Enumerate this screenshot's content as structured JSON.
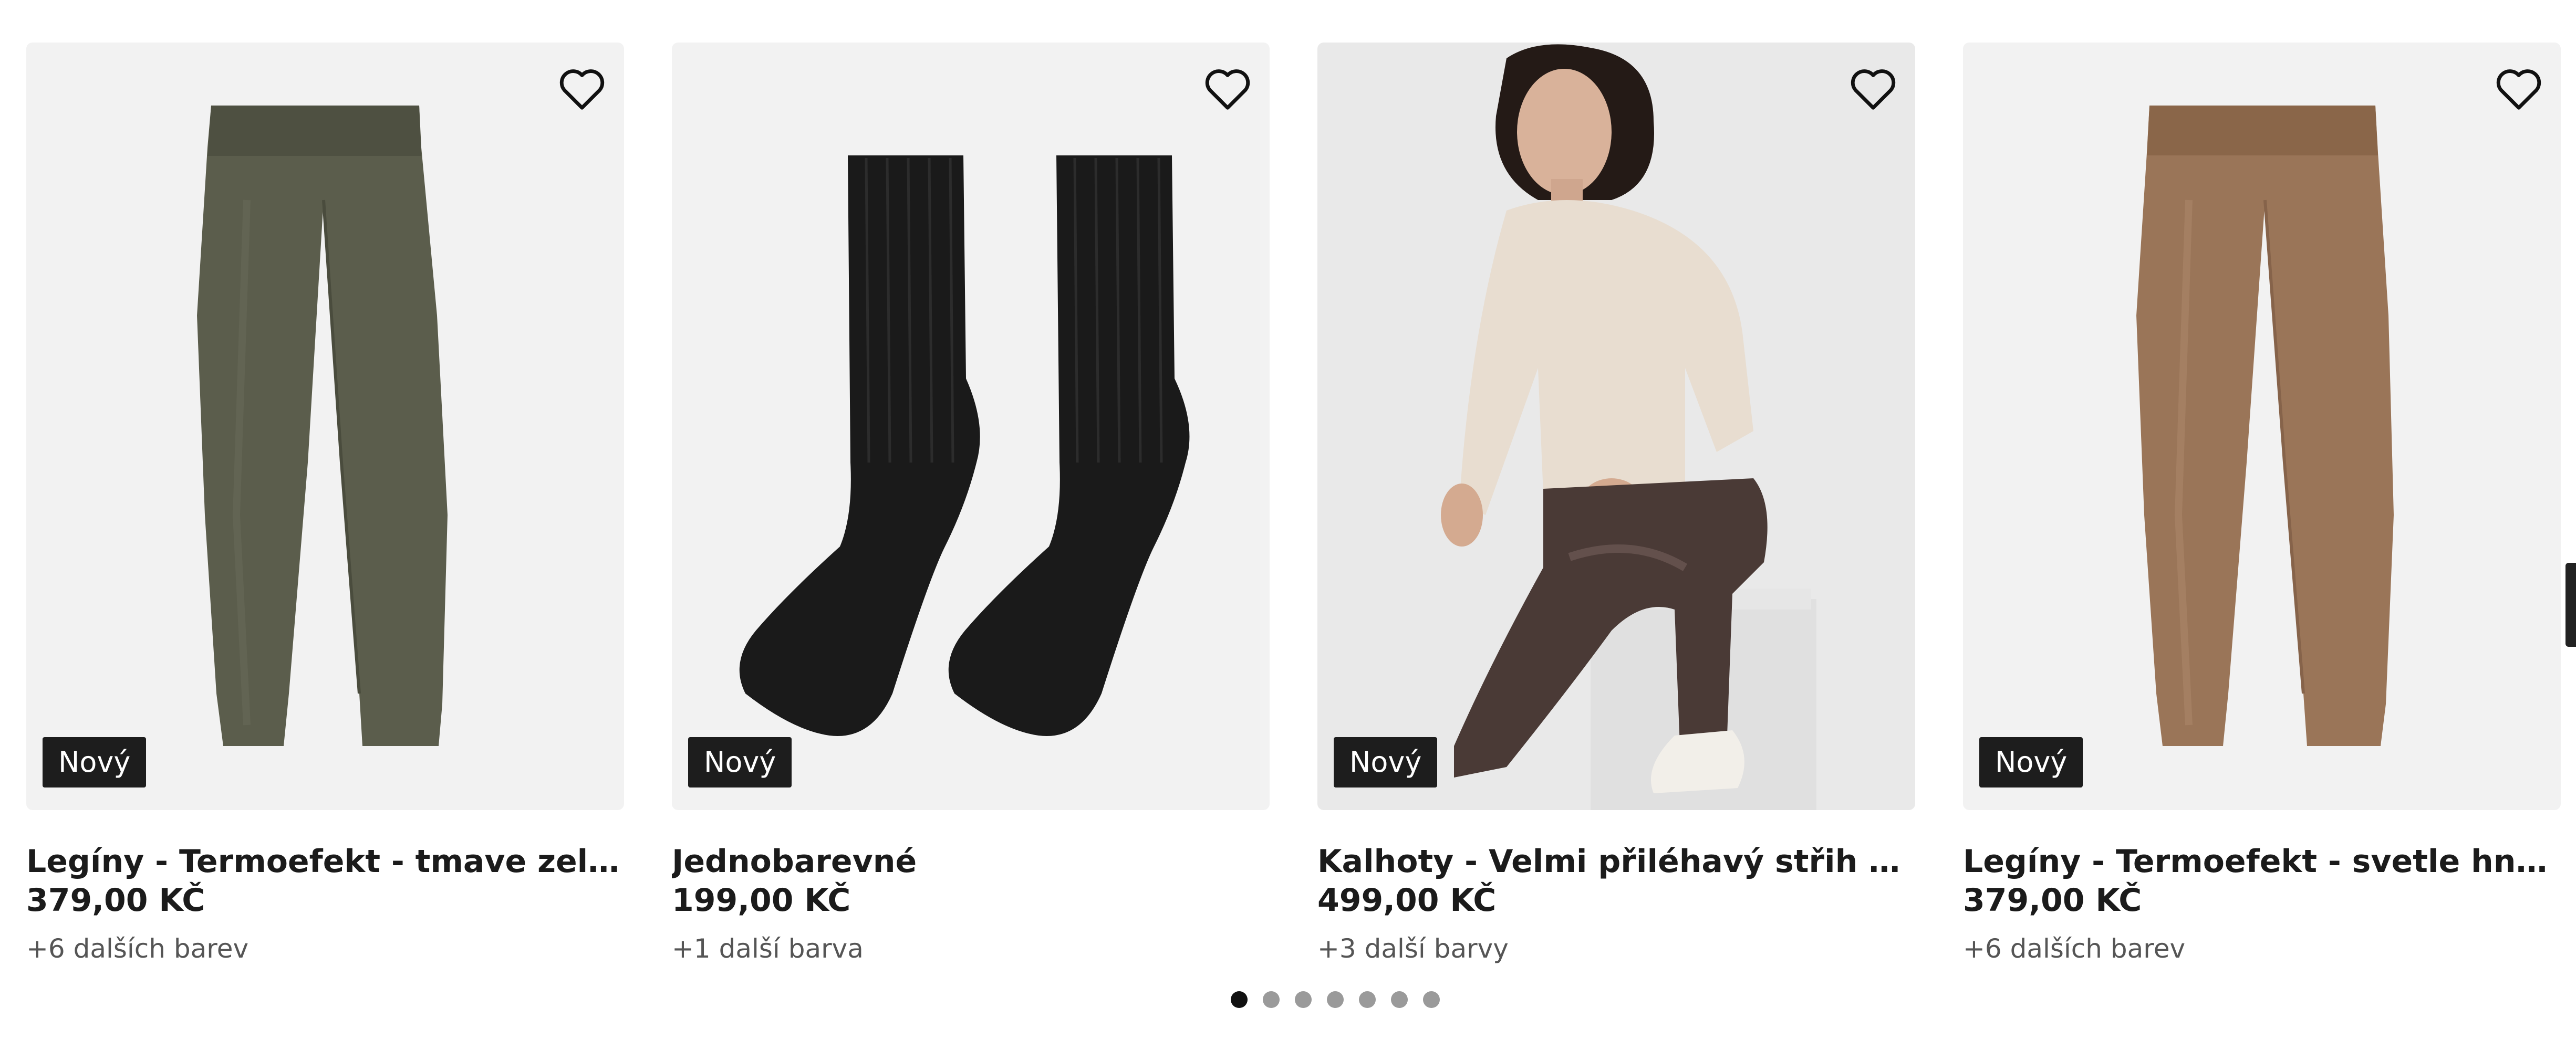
{
  "products": [
    {
      "title": "Legíny - Termoefekt - tmave zelena",
      "price": "379,00 KČ",
      "colors_note": "+6 dalších barev",
      "badge": "Nový",
      "color": "#5b5d4c",
      "icon": "heart-outline-icon"
    },
    {
      "title": "Jednobarevné",
      "price": "199,00 KČ",
      "colors_note": "+1 další barva",
      "badge": "Nový",
      "color": "#1a1a1a",
      "icon": "heart-outline-icon"
    },
    {
      "title": "Kalhoty - Velmi přiléhavý střih Skinny ...",
      "price": "499,00 KČ",
      "colors_note": "+3 další barvy",
      "badge": "Nový",
      "color": "#4a3a36",
      "icon": "heart-outline-icon"
    },
    {
      "title": "Legíny - Termoefekt - svetle hneda",
      "price": "379,00 KČ",
      "colors_note": "+6 dalších barev",
      "badge": "Nový",
      "color": "#9a7558",
      "icon": "heart-outline-icon"
    }
  ],
  "pagination": {
    "count": 7,
    "active": 1
  }
}
